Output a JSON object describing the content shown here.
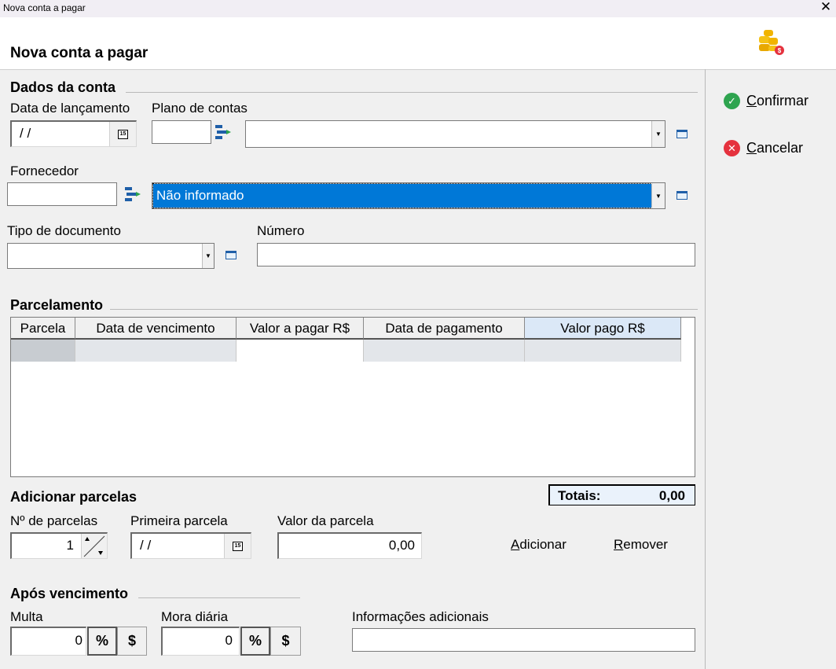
{
  "window": {
    "title": "Nova conta a pagar",
    "close": "✕"
  },
  "header": {
    "title": "Nova conta a pagar",
    "icon": "coins-dollar-icon"
  },
  "dados": {
    "section": "Dados da conta",
    "data_lancamento": {
      "label": "Data de lançamento",
      "value": " /  /"
    },
    "plano_contas": {
      "label": "Plano de contas",
      "code": "",
      "selected": ""
    },
    "fornecedor": {
      "label": "Fornecedor",
      "code": "",
      "selected": "Não informado"
    },
    "tipo_documento": {
      "label": "Tipo de documento",
      "selected": ""
    },
    "numero": {
      "label": "Número",
      "value": ""
    }
  },
  "parcelamento": {
    "section": "Parcelamento",
    "columns": [
      "Parcela",
      "Data de vencimento",
      "Valor a pagar R$",
      "Data de pagamento",
      "Valor pago R$"
    ]
  },
  "totais": {
    "label": "Totais:",
    "value": "0,00"
  },
  "adicionar": {
    "section": "Adicionar parcelas",
    "num_parcelas": {
      "label": "Nº de parcelas",
      "value": "1"
    },
    "primeira_parcela": {
      "label": "Primeira parcela",
      "value": " /  /"
    },
    "valor_parcela": {
      "label": "Valor da parcela",
      "value": "0,00"
    },
    "add_label": "Adicionar",
    "remove_label": "Remover"
  },
  "vencimento": {
    "section": "Após vencimento",
    "multa": {
      "label": "Multa",
      "value": "0",
      "pct": "%",
      "money": "$"
    },
    "mora": {
      "label": "Mora diária",
      "value": "0",
      "pct": "%",
      "money": "$"
    },
    "info": {
      "label": "Informações adicionais",
      "value": ""
    }
  },
  "sidebar": {
    "confirm_label": "Confirmar",
    "cancel_label": "Cancelar",
    "confirm_color": "#2ea44f",
    "cancel_color": "#e5323e"
  },
  "colors": {
    "selection": "#0078d7",
    "grid_header_last": "#dbe8f7"
  }
}
